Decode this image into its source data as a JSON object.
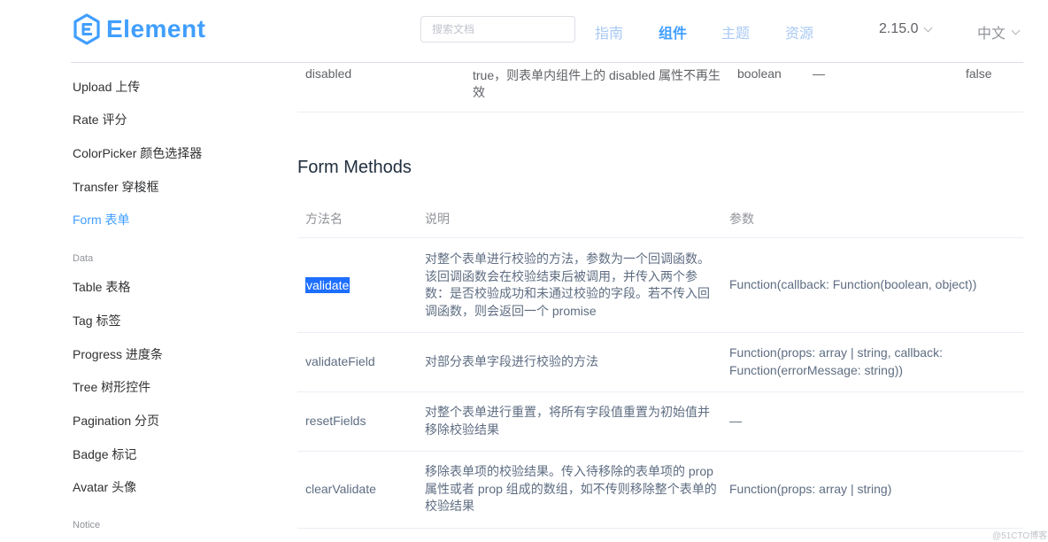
{
  "header": {
    "logo_text": "Element",
    "search_placeholder": "搜索文档",
    "nav": [
      "指南",
      "组件",
      "主题",
      "资源"
    ],
    "active_nav": "组件",
    "version": "2.15.0",
    "language": "中文",
    "brand_color": "#409eff"
  },
  "sidebar": {
    "items": [
      "Upload 上传",
      "Rate 评分",
      "ColorPicker 颜色选择器",
      "Transfer 穿梭框",
      "Form 表单"
    ],
    "active_item": "Form 表单",
    "group_data": "Data",
    "data_items": [
      "Table 表格",
      "Tag 标签",
      "Progress 进度条",
      "Tree 树形控件",
      "Pagination 分页",
      "Badge 标记",
      "Avatar 头像"
    ],
    "group_notice": "Notice"
  },
  "prev_table_row": {
    "name": "disabled",
    "desc_line1": "true，则表单内组件上的 disabled 属性不再生",
    "desc_line2": "效",
    "type": "boolean",
    "options": "—",
    "default": "false"
  },
  "methods_section": {
    "title": "Form Methods",
    "headers": [
      "方法名",
      "说明",
      "参数"
    ],
    "rows": [
      {
        "name": "validate",
        "desc": [
          "对整个表单进行校验的方法，参数为一个回调函数。",
          "该回调函数会在校验结束后被调用，并传入两个参",
          "数：是否校验成功和未通过校验的字段。若不传入回",
          "调函数，则会返回一个 promise"
        ],
        "params": [
          "Function(callback: Function(boolean, object))"
        ]
      },
      {
        "name": "validateField",
        "desc": [
          "对部分表单字段进行校验的方法"
        ],
        "params": [
          "Function(props: array | string, callback:",
          "Function(errorMessage: string))"
        ]
      },
      {
        "name": "resetFields",
        "desc": [
          "对整个表单进行重置，将所有字段值重置为初始值并",
          "移除校验结果"
        ],
        "params": [
          "—"
        ]
      },
      {
        "name": "clearValidate",
        "desc": [
          "移除表单项的校验结果。传入待移除的表单项的 prop",
          "属性或者 prop 组成的数组，如不传则移除整个表单的",
          "校验结果"
        ],
        "params": [
          "Function(props: array | string)"
        ]
      }
    ]
  },
  "watermark": "@51CTO博客"
}
